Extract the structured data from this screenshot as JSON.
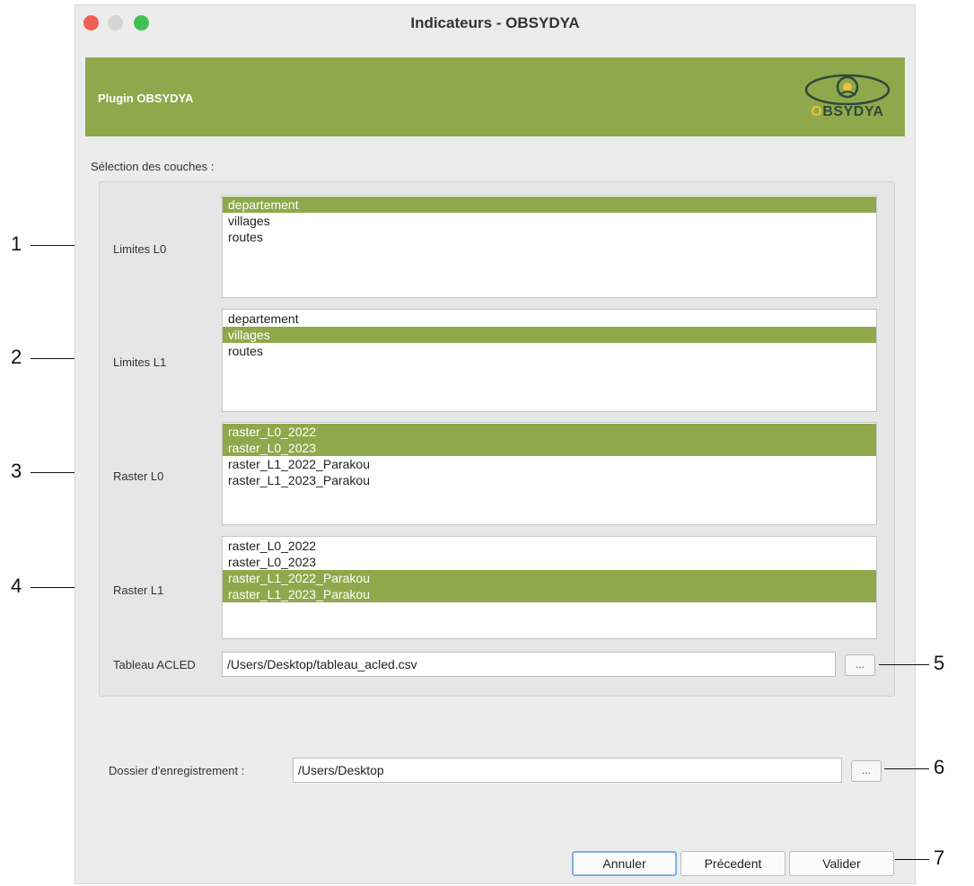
{
  "window": {
    "title": "Indicateurs - OBSYDYA"
  },
  "header": {
    "title": "Plugin OBSYDYA",
    "logo_text_first": "O",
    "logo_text_rest": "BSYDYA"
  },
  "section": {
    "label": "Sélection des couches :"
  },
  "lists": [
    {
      "label": "Limites L0",
      "items": [
        {
          "text": "departement",
          "selected": true
        },
        {
          "text": "villages",
          "selected": false
        },
        {
          "text": "routes",
          "selected": false
        }
      ]
    },
    {
      "label": "Limites L1",
      "items": [
        {
          "text": "departement",
          "selected": false
        },
        {
          "text": "villages",
          "selected": true
        },
        {
          "text": "routes",
          "selected": false
        }
      ]
    },
    {
      "label": "Raster L0",
      "items": [
        {
          "text": "raster_L0_2022",
          "selected": true
        },
        {
          "text": "raster_L0_2023",
          "selected": true
        },
        {
          "text": "raster_L1_2022_Parakou",
          "selected": false
        },
        {
          "text": "raster_L1_2023_Parakou",
          "selected": false
        }
      ]
    },
    {
      "label": "Raster L1",
      "items": [
        {
          "text": "raster_L0_2022",
          "selected": false
        },
        {
          "text": "raster_L0_2023",
          "selected": false
        },
        {
          "text": "raster_L1_2022_Parakou",
          "selected": true
        },
        {
          "text": "raster_L1_2023_Parakou",
          "selected": true
        }
      ]
    }
  ],
  "acled": {
    "label": "Tableau ACLED",
    "value": "/Users/Desktop/tableau_acled.csv",
    "browse_label": "..."
  },
  "output": {
    "label": "Dossier d'enregistrement :",
    "value": "/Users/Desktop",
    "browse_label": "..."
  },
  "buttons": {
    "cancel": "Annuler",
    "previous": "Précedent",
    "validate": "Valider"
  },
  "annotations": [
    "1",
    "2",
    "3",
    "4",
    "5",
    "6",
    "7"
  ],
  "colors": {
    "accent": "#8fa84b",
    "window_bg": "#ececec"
  }
}
